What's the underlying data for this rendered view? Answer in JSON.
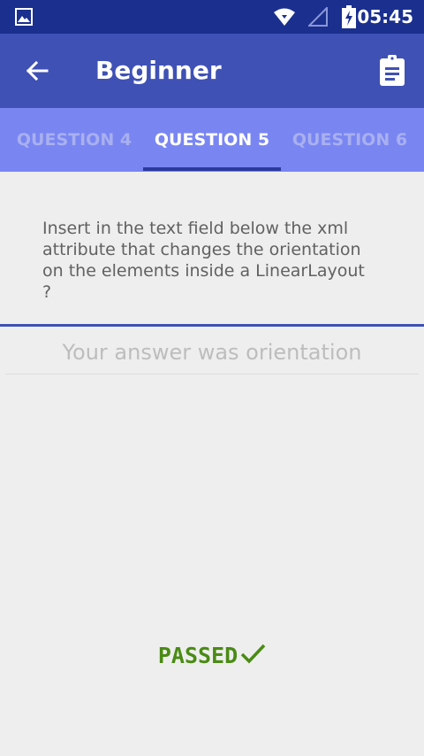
{
  "status_bar": {
    "time": "05:45",
    "icons": [
      "image-icon",
      "wifi-icon",
      "signal-icon",
      "battery-icon"
    ]
  },
  "app_bar": {
    "title": "Beginner",
    "back_icon": "arrow-left-icon",
    "action_icon": "clipboard-icon"
  },
  "tabs": [
    {
      "label": "QUESTION 4",
      "active": false
    },
    {
      "label": "QUESTION 5",
      "active": true
    },
    {
      "label": "QUESTION 6",
      "active": false
    }
  ],
  "question": {
    "text": "Insert in the text field below the xml attribute that changes the orientation on the elements inside a LinearLayout ?"
  },
  "answer": {
    "text": "Your answer was orientation"
  },
  "result": {
    "label": "PASSED",
    "icon": "check-icon",
    "color": "#4a8b14"
  },
  "colors": {
    "status_bar": "#1a2f8e",
    "app_bar": "#3f51b5",
    "tab_bar": "#7986f2",
    "background": "#eeeeee"
  }
}
